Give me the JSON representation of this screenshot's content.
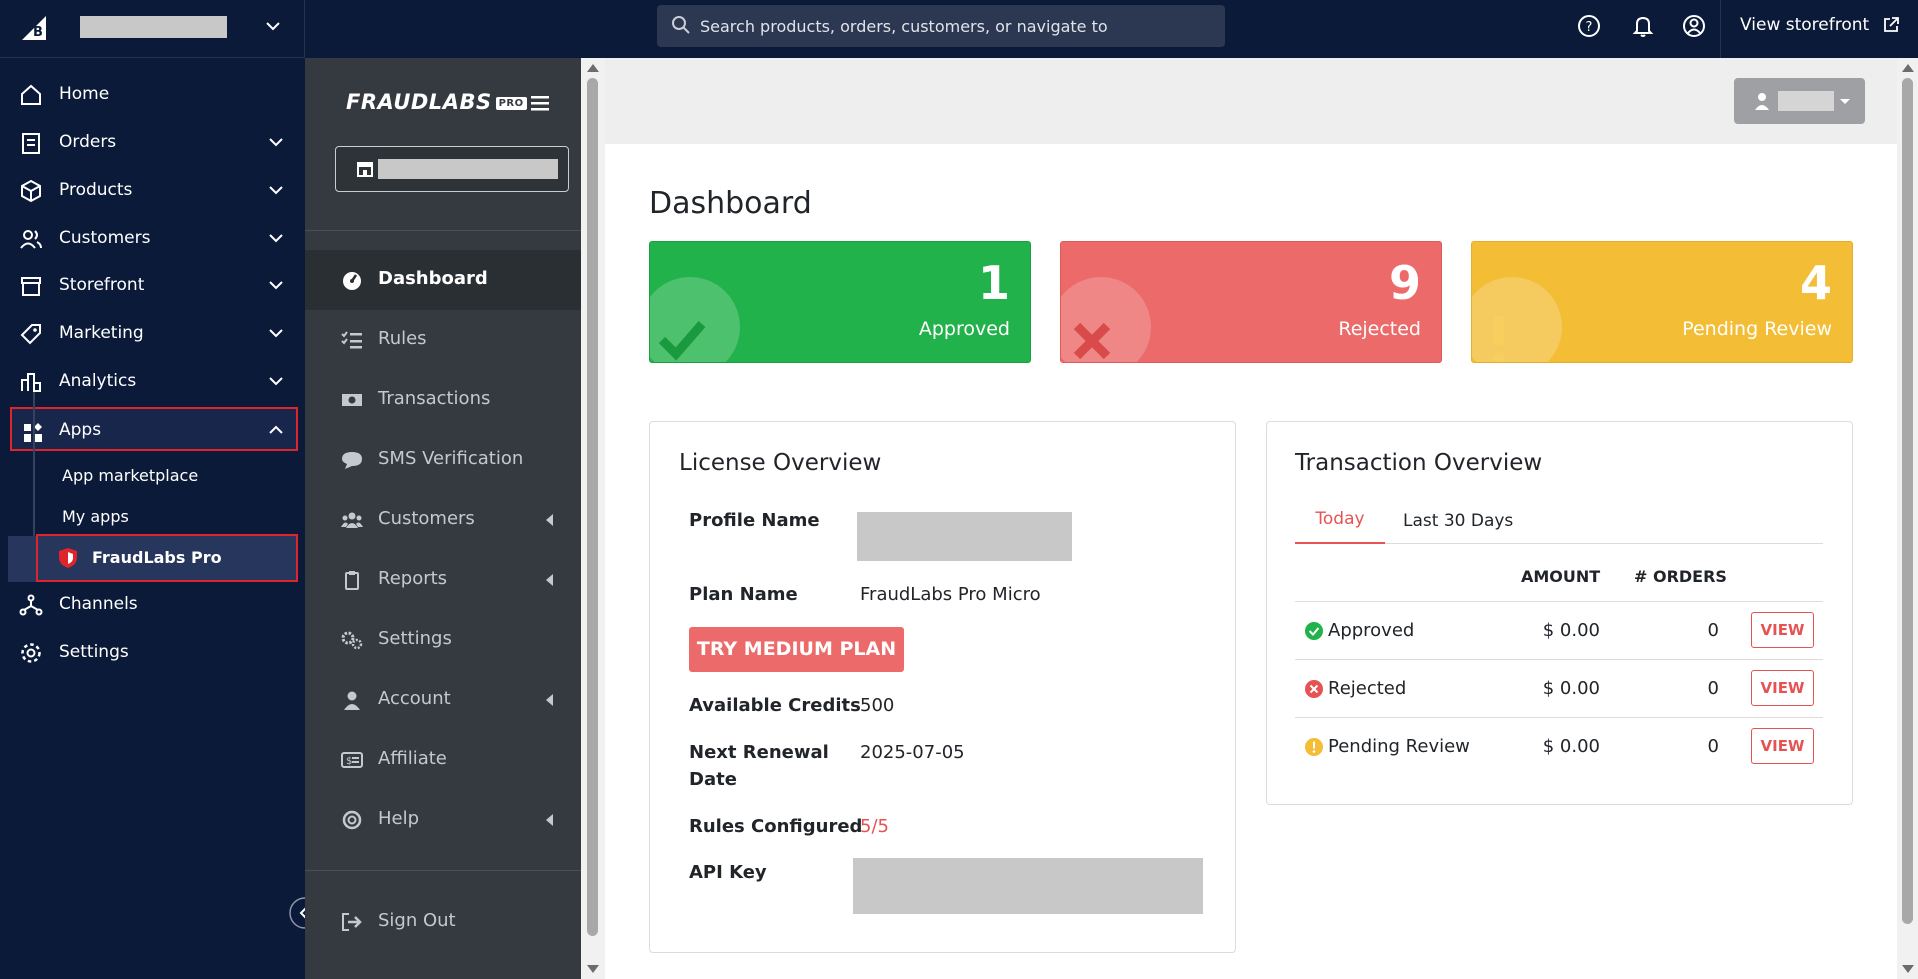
{
  "topbar": {
    "search_placeholder": "Search products, orders, customers, or navigate to",
    "view_storefront": "View storefront"
  },
  "sidebar": {
    "items": [
      {
        "label": "Home",
        "icon": "home-icon"
      },
      {
        "label": "Orders",
        "icon": "orders-icon"
      },
      {
        "label": "Products",
        "icon": "products-icon"
      },
      {
        "label": "Customers",
        "icon": "customers-icon"
      },
      {
        "label": "Storefront",
        "icon": "storefront-icon"
      },
      {
        "label": "Marketing",
        "icon": "marketing-icon"
      },
      {
        "label": "Analytics",
        "icon": "analytics-icon"
      },
      {
        "label": "Apps",
        "icon": "apps-icon"
      },
      {
        "label": "Channels",
        "icon": "channels-icon"
      },
      {
        "label": "Settings",
        "icon": "settings-icon"
      }
    ],
    "apps_sub": [
      "App marketplace",
      "My apps",
      "FraudLabs Pro"
    ]
  },
  "app": {
    "brand": "FRAUDLABS",
    "brand_badge": "PRO",
    "nav": [
      {
        "label": "Dashboard",
        "icon": "dashboard-icon"
      },
      {
        "label": "Rules",
        "icon": "rules-icon"
      },
      {
        "label": "Transactions",
        "icon": "transactions-icon"
      },
      {
        "label": "SMS Verification",
        "icon": "sms-icon"
      },
      {
        "label": "Customers",
        "icon": "customers-icon"
      },
      {
        "label": "Reports",
        "icon": "reports-icon"
      },
      {
        "label": "Settings",
        "icon": "settings-icon"
      },
      {
        "label": "Account",
        "icon": "account-icon"
      },
      {
        "label": "Affiliate",
        "icon": "affiliate-icon"
      },
      {
        "label": "Help",
        "icon": "help-icon"
      },
      {
        "label": "Sign Out",
        "icon": "sign-out-icon"
      }
    ]
  },
  "dashboard": {
    "title": "Dashboard",
    "stats": [
      {
        "value": "1",
        "label": "Approved",
        "color": "#22b24c"
      },
      {
        "value": "9",
        "label": "Rejected",
        "color": "#ec6a6a"
      },
      {
        "value": "4",
        "label": "Pending Review",
        "color": "#f3bd36"
      }
    ],
    "license": {
      "title": "License Overview",
      "profile_name_label": "Profile Name",
      "plan_name_label": "Plan Name",
      "plan_name": "FraudLabs Pro Micro",
      "try_button": "TRY MEDIUM PLAN",
      "credits_label": "Available Credits",
      "credits": "500",
      "renewal_label_1": "Next Renewal",
      "renewal_label_2": "Date",
      "renewal": "2025-07-05",
      "rules_label": "Rules Configured",
      "rules": "5/5",
      "api_key_label": "API Key"
    },
    "transactions": {
      "title": "Transaction Overview",
      "tab_today": "Today",
      "tab_30": "Last 30 Days",
      "col_amount": "AMOUNT",
      "col_orders": "# ORDERS",
      "rows": [
        {
          "status": "Approved",
          "amount": "$ 0.00",
          "orders": "0",
          "action": "VIEW",
          "color": "#22b24c"
        },
        {
          "status": "Rejected",
          "amount": "$ 0.00",
          "orders": "0",
          "action": "VIEW",
          "color": "#e55353"
        },
        {
          "status": "Pending Review",
          "amount": "$ 0.00",
          "orders": "0",
          "action": "VIEW",
          "color": "#f3bd36"
        }
      ]
    }
  }
}
